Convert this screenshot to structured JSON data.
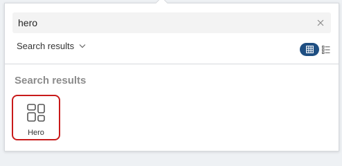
{
  "search": {
    "value": "hero",
    "clear_icon": "close-icon"
  },
  "scope": {
    "label": "Search results",
    "icon": "chevron-down-icon"
  },
  "view_toggle": {
    "active": "grid",
    "grid_icon": "grid-view-icon",
    "list_icon": "list-view-icon",
    "accent_color": "#1f4f82"
  },
  "results": {
    "heading": "Search results",
    "items": [
      {
        "label": "Hero",
        "icon": "hero-section-icon",
        "highlight_color": "#c81a1a"
      }
    ]
  }
}
